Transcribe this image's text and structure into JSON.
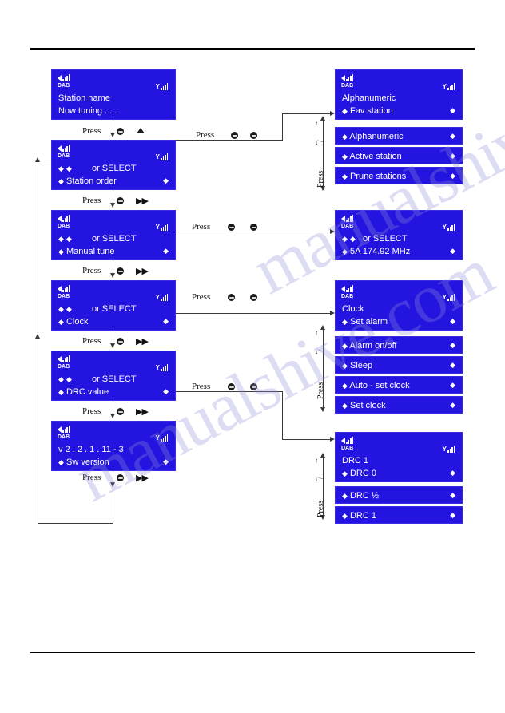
{
  "document": {
    "rules": [
      "top",
      "bottom"
    ],
    "watermark_text": "manualshive.com"
  },
  "icons": {
    "speaker": "speaker-volume-icon",
    "dab": "DAB",
    "signal": "signal-strength-icon",
    "diamond": "◆",
    "triangle_up": "▲",
    "fast_forward": "▶▶",
    "knob": "select-knob-icon",
    "arrow_up": "↑",
    "arrow_down": "↓",
    "slash": "/"
  },
  "labels": {
    "press": "Press",
    "press_vertical": "Press"
  },
  "left_column": {
    "screens": [
      {
        "id": "station-name",
        "line1": "Station  name",
        "line2": "Now  tuning . . .",
        "has_select": false,
        "has_right_diamond": false
      },
      {
        "id": "station-order",
        "select_text": "or  SELECT",
        "line2": "Station  order",
        "has_select": true,
        "has_right_diamond": true
      },
      {
        "id": "manual-tune",
        "select_text": "or  SELECT",
        "line2": "Manual  tune",
        "has_select": true,
        "has_right_diamond": true
      },
      {
        "id": "clock",
        "select_text": "or  SELECT",
        "line2": "Clock",
        "has_select": true,
        "has_right_diamond": true
      },
      {
        "id": "drc-value",
        "select_text": "or  SELECT",
        "line2": "DRC  value",
        "has_select": true,
        "has_right_diamond": true
      },
      {
        "id": "sw-version",
        "line1": "v 2 . 2 . 1 .  11 - 3",
        "line2": "Sw  version",
        "has_select": false,
        "has_right_diamond": true
      }
    ],
    "transitions": [
      {
        "label": "Press",
        "knob": true,
        "glyph": "▲"
      },
      {
        "label": "Press",
        "knob": true,
        "glyph": "▶▶"
      },
      {
        "label": "Press",
        "knob": true,
        "glyph": "▶▶"
      },
      {
        "label": "Press",
        "knob": true,
        "glyph": "▶▶"
      },
      {
        "label": "Press",
        "knob": true,
        "glyph": "▶▶"
      },
      {
        "label": "Press",
        "knob": true,
        "glyph": "▶▶"
      }
    ]
  },
  "right_column": {
    "groups": [
      {
        "id": "station-order-menu",
        "header": {
          "line1": "Alphanumeric",
          "line2": "Fav  station"
        },
        "rows": [
          "Alphanumeric",
          "Active  station",
          "Prune  stations"
        ]
      },
      {
        "id": "manual-tune-screen",
        "header": {
          "select_text": "or  SELECT",
          "line2": "5A      174.92 MHz"
        },
        "rows": []
      },
      {
        "id": "clock-menu",
        "header": {
          "line1": "Clock",
          "line2": "Set  alarm"
        },
        "rows": [
          "Alarm  on/off",
          "Sleep",
          "Auto - set  clock",
          "Set  clock"
        ]
      },
      {
        "id": "drc-menu",
        "header": {
          "line1": "DRC  1",
          "line2": "DRC 0"
        },
        "rows": [
          "DRC  ½",
          "DRC  1"
        ]
      }
    ],
    "cross_transitions": [
      {
        "label": "Press",
        "knobs": 2
      },
      {
        "label": "Press",
        "knobs": 2
      },
      {
        "label": "Press",
        "knobs": 2
      },
      {
        "label": "Press",
        "knobs": 2
      }
    ],
    "scroll_hints": [
      {
        "up": "↑",
        "slash": "/",
        "down": "↓",
        "label": "Press"
      },
      {
        "up": "↑",
        "slash": "/",
        "down": "↓",
        "label": "Press"
      },
      {
        "up": "↑",
        "slash": "/",
        "down": "↓",
        "label": "Press"
      }
    ]
  },
  "colors": {
    "lcd_background": "#2414e0",
    "lcd_text": "#ffffff",
    "line": "#3a3a3a",
    "rule": "#000000",
    "watermark": "#8f8fd8"
  }
}
